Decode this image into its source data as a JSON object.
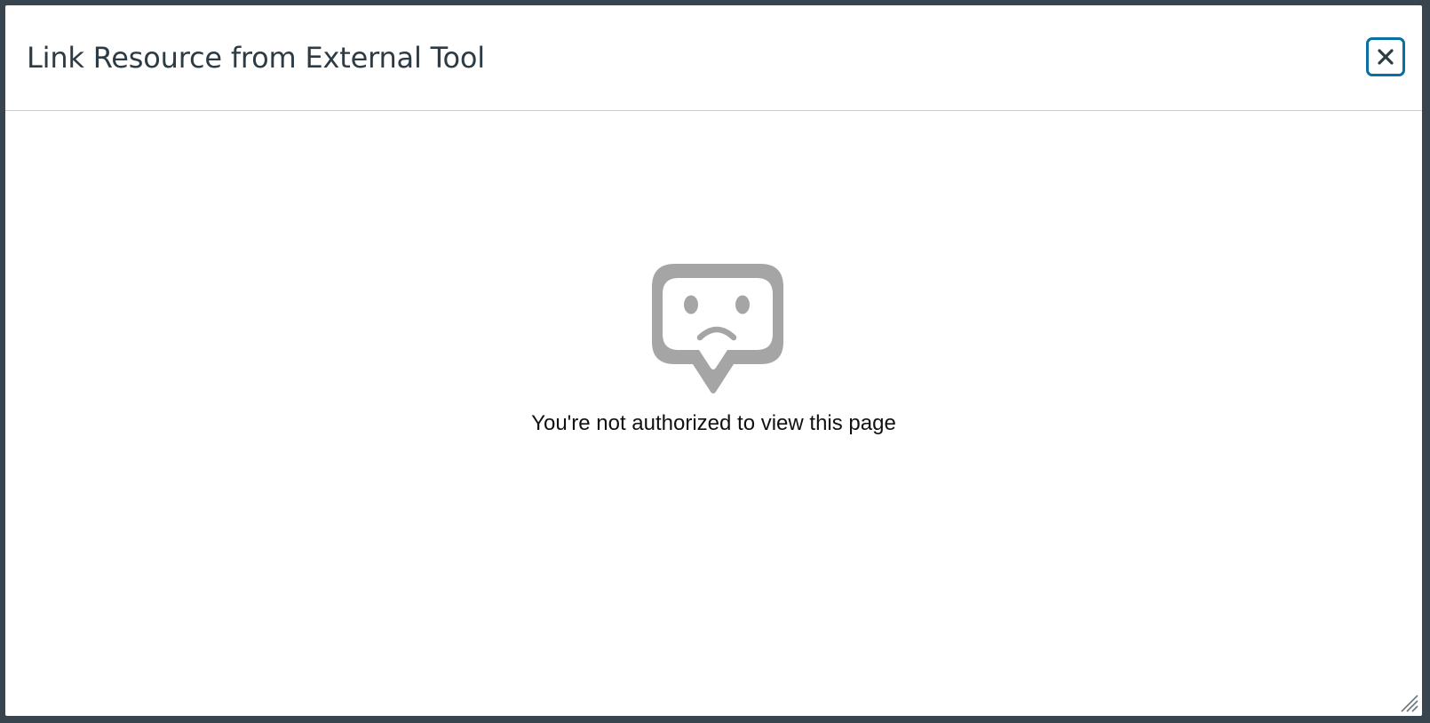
{
  "dialog": {
    "title": "Link Resource from External Tool",
    "close_icon": "close-icon",
    "resize_icon": "resize-grip-icon"
  },
  "content": {
    "error_icon": "sad-face-speech-bubble-icon",
    "message": "You're not authorized to view this page"
  },
  "colors": {
    "backdrop": "#38454f",
    "title_text": "#2d3b45",
    "focus_ring": "#0770a3",
    "icon_gray": "#a5a5a5",
    "divider": "#c7cdd1"
  }
}
